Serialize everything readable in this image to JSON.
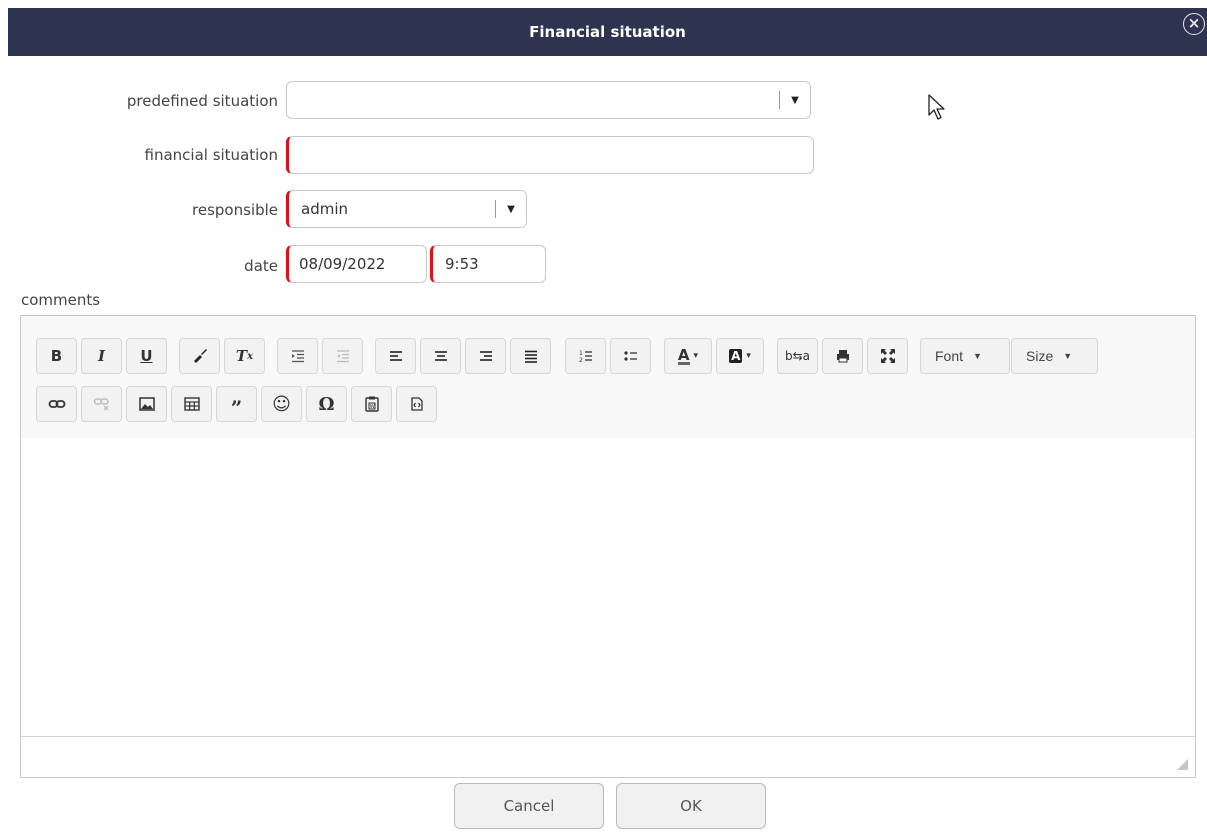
{
  "dialog": {
    "title": "Financial situation",
    "close_icon": "close-circle-icon"
  },
  "form": {
    "predefined_label": "predefined situation",
    "predefined_value": "",
    "financial_label": "financial situation",
    "financial_value": "",
    "responsible_label": "responsible",
    "responsible_value": "admin",
    "date_label": "date",
    "date_value": "08/09/2022",
    "time_value": "9:53",
    "comments_label": "comments"
  },
  "toolbar": {
    "row1": [
      {
        "name": "bold-button",
        "icon": "B"
      },
      {
        "name": "italic-button",
        "icon": "I"
      },
      {
        "name": "underline-button",
        "icon": "U"
      },
      {
        "name": "format-painter-button",
        "icon": "brush-icon"
      },
      {
        "name": "clear-format-button",
        "icon": "Tx"
      },
      {
        "name": "indent-button",
        "icon": "indent-icon"
      },
      {
        "name": "outdent-button",
        "icon": "outdent-icon"
      },
      {
        "name": "align-left-button",
        "icon": "align-left-icon"
      },
      {
        "name": "align-center-button",
        "icon": "align-center-icon"
      },
      {
        "name": "align-right-button",
        "icon": "align-right-icon"
      },
      {
        "name": "justify-button",
        "icon": "justify-icon"
      },
      {
        "name": "numbered-list-button",
        "icon": "numbered-list-icon"
      },
      {
        "name": "bulleted-list-button",
        "icon": "bulleted-list-icon"
      },
      {
        "name": "text-color-button",
        "icon": "text-color-icon"
      },
      {
        "name": "background-color-button",
        "icon": "background-color-icon"
      },
      {
        "name": "replace-button",
        "icon": "replace-icon"
      },
      {
        "name": "print-button",
        "icon": "print-icon"
      },
      {
        "name": "maximize-button",
        "icon": "maximize-icon"
      }
    ],
    "font_label": "Font",
    "size_label": "Size",
    "row2": [
      {
        "name": "link-button",
        "icon": "link-icon"
      },
      {
        "name": "unlink-button",
        "icon": "unlink-icon"
      },
      {
        "name": "image-button",
        "icon": "image-icon"
      },
      {
        "name": "table-button",
        "icon": "table-icon"
      },
      {
        "name": "blockquote-button",
        "icon": "quote-icon"
      },
      {
        "name": "emoji-button",
        "icon": "smiley-icon"
      },
      {
        "name": "special-char-button",
        "icon": "omega-icon"
      },
      {
        "name": "paste-word-button",
        "icon": "paste-word-icon"
      },
      {
        "name": "source-button",
        "icon": "source-icon"
      }
    ]
  },
  "buttons": {
    "cancel_label": "Cancel",
    "ok_label": "OK"
  }
}
